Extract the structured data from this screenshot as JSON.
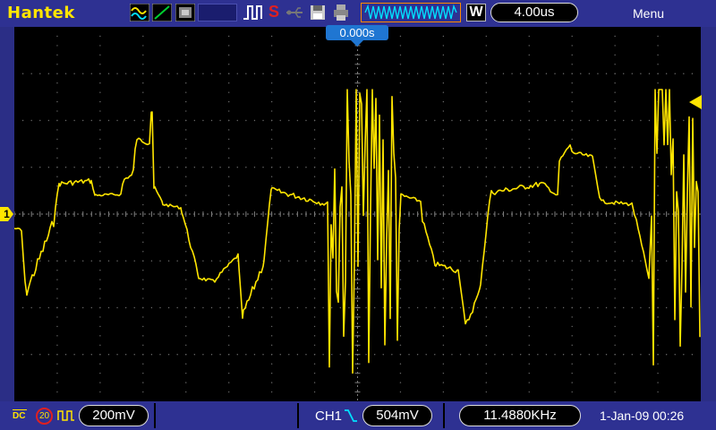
{
  "brand": "Hantek",
  "toolbar": {
    "icons": [
      "wave-display-icon",
      "cursor-line-icon",
      "persistence-icon",
      "run-stop-icon",
      "single-trigger-icon",
      "usb-icon",
      "save-icon",
      "printer-icon"
    ],
    "single_label": "S",
    "w_label": "W",
    "timebase": "4.00us",
    "menu_label": "Menu"
  },
  "screen": {
    "trigger_position": "0.000s",
    "channel_marker": "1"
  },
  "status": {
    "coupling": "DC",
    "bandwidth_limit": "20",
    "volts_per_div": "200mV",
    "trigger_source": "CH1",
    "trigger_level": "504mV",
    "frequency": "11.4880KHz",
    "datetime": "1-Jan-09 00:26"
  },
  "colors": {
    "trace": "#ffe500",
    "background": "#2e3192",
    "screen": "#000000",
    "trigger_accent": "#1f76d2"
  }
}
